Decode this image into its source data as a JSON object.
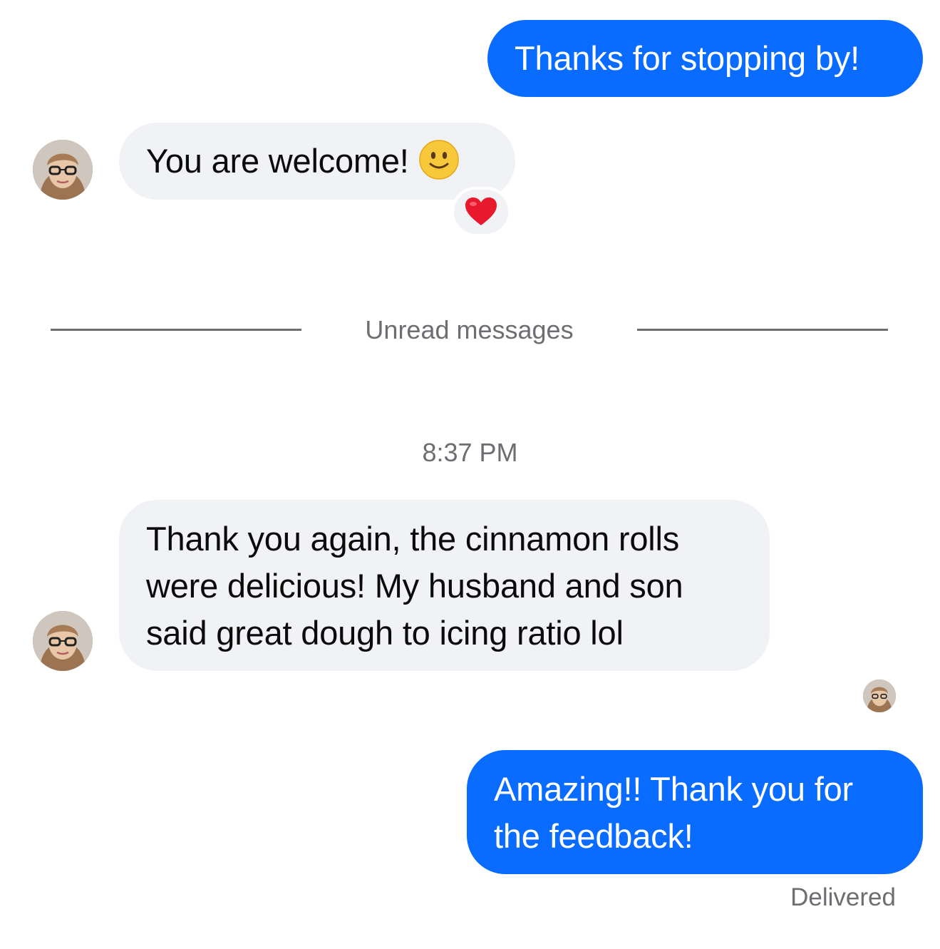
{
  "messages": [
    {
      "direction": "outgoing",
      "lines": [
        "Thanks for stopping by!"
      ]
    },
    {
      "direction": "incoming",
      "lines": [
        "You are welcome!"
      ],
      "emoji": "slightly-smiling-face",
      "reaction": "red-heart"
    },
    {
      "direction": "incoming",
      "lines": [
        "Thank you again, the cinnamon rolls",
        "were delicious! My husband and son",
        "said great dough to icing ratio lol"
      ]
    },
    {
      "direction": "outgoing",
      "lines": [
        "Amazing!! Thank you for",
        "the feedback!"
      ]
    }
  ],
  "divider": {
    "label": "Unread messages"
  },
  "timestamp": "8:37 PM",
  "status": "Delivered",
  "colors": {
    "outgoing_bubble": "#0a6cff",
    "incoming_bubble": "#f1f2f6",
    "meta_text": "#6d6d72"
  }
}
